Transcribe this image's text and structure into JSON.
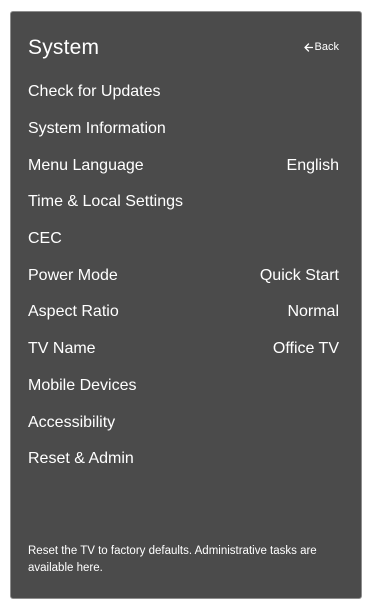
{
  "header": {
    "title": "System",
    "back_label": "Back"
  },
  "menu": {
    "items": [
      {
        "label": "Check for Updates",
        "value": ""
      },
      {
        "label": "System Information",
        "value": ""
      },
      {
        "label": "Menu Language",
        "value": "English"
      },
      {
        "label": "Time & Local Settings",
        "value": ""
      },
      {
        "label": "CEC",
        "value": ""
      },
      {
        "label": "Power Mode",
        "value": "Quick Start"
      },
      {
        "label": "Aspect Ratio",
        "value": "Normal"
      },
      {
        "label": "TV Name",
        "value": "Office TV"
      },
      {
        "label": "Mobile Devices",
        "value": ""
      },
      {
        "label": "Accessibility",
        "value": ""
      },
      {
        "label": "Reset & Admin",
        "value": ""
      }
    ]
  },
  "description": {
    "text": "Reset the TV to factory defaults. Administrative tasks are available here."
  },
  "colors": {
    "panel_background": "#4b4b4b",
    "panel_border": "#8e8e8e",
    "text": "#ffffff"
  }
}
